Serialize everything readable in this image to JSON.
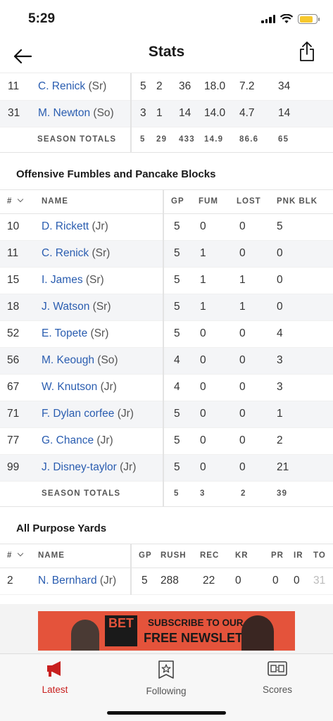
{
  "status": {
    "time": "5:29"
  },
  "nav": {
    "title": "Stats"
  },
  "top_table": {
    "rows": [
      {
        "num": "11",
        "name": "C. Renick",
        "yr": "(Sr)",
        "vals": [
          "5",
          "2",
          "36",
          "18.0",
          "7.2",
          "34"
        ]
      },
      {
        "num": "31",
        "name": "M. Newton",
        "yr": "(So)",
        "vals": [
          "3",
          "1",
          "14",
          "14.0",
          "4.7",
          "14"
        ]
      }
    ],
    "totals_label": "SEASON TOTALS",
    "totals": [
      "5",
      "29",
      "433",
      "14.9",
      "86.6",
      "65"
    ]
  },
  "fumbles": {
    "title": "Offensive Fumbles and Pancake Blocks",
    "headers": {
      "num": "#",
      "name": "NAME",
      "gp": "GP",
      "fum": "FUM",
      "lost": "LOST",
      "pnk": "PNK BLK"
    },
    "rows": [
      {
        "num": "10",
        "name": "D. Rickett",
        "yr": "(Jr)",
        "gp": "5",
        "fum": "0",
        "lost": "0",
        "pnk": "5"
      },
      {
        "num": "11",
        "name": "C. Renick",
        "yr": "(Sr)",
        "gp": "5",
        "fum": "1",
        "lost": "0",
        "pnk": "0"
      },
      {
        "num": "15",
        "name": "I. James",
        "yr": "(Sr)",
        "gp": "5",
        "fum": "1",
        "lost": "1",
        "pnk": "0"
      },
      {
        "num": "18",
        "name": "J. Watson",
        "yr": "(Sr)",
        "gp": "5",
        "fum": "1",
        "lost": "1",
        "pnk": "0"
      },
      {
        "num": "52",
        "name": "E. Topete",
        "yr": "(Sr)",
        "gp": "5",
        "fum": "0",
        "lost": "0",
        "pnk": "4"
      },
      {
        "num": "56",
        "name": "M. Keough",
        "yr": "(So)",
        "gp": "4",
        "fum": "0",
        "lost": "0",
        "pnk": "3"
      },
      {
        "num": "67",
        "name": "W. Knutson",
        "yr": "(Jr)",
        "gp": "4",
        "fum": "0",
        "lost": "0",
        "pnk": "3"
      },
      {
        "num": "71",
        "name": "F. Dylan corfee",
        "yr": "(Jr)",
        "gp": "5",
        "fum": "0",
        "lost": "0",
        "pnk": "1"
      },
      {
        "num": "77",
        "name": "G. Chance",
        "yr": "(Jr)",
        "gp": "5",
        "fum": "0",
        "lost": "0",
        "pnk": "2"
      },
      {
        "num": "99",
        "name": "J. Disney-taylor",
        "yr": "(Jr)",
        "gp": "5",
        "fum": "0",
        "lost": "0",
        "pnk": "21"
      }
    ],
    "totals_label": "SEASON TOTALS",
    "totals": {
      "gp": "5",
      "fum": "3",
      "lost": "2",
      "pnk": "39"
    }
  },
  "apy": {
    "title": "All Purpose Yards",
    "headers": {
      "num": "#",
      "name": "NAME",
      "gp": "GP",
      "rush": "RUSH",
      "rec": "REC",
      "kr": "KR",
      "pr": "PR",
      "ir": "IR",
      "to": "TO"
    },
    "rows": [
      {
        "num": "2",
        "name": "N. Bernhard",
        "yr": "(Jr)",
        "gp": "5",
        "rush": "288",
        "rec": "22",
        "kr": "0",
        "pr": "0",
        "ir": "0",
        "to": "31"
      }
    ]
  },
  "ad": {
    "logo": "BET",
    "line1": "SUBSCRIBE TO OUR",
    "line2": "FREE NEWSLETTER"
  },
  "tabs": [
    {
      "label": "Latest",
      "icon": "megaphone-icon"
    },
    {
      "label": "Following",
      "icon": "star-doc-icon"
    },
    {
      "label": "Scores",
      "icon": "scoreboard-icon"
    }
  ],
  "colors": {
    "accent": "#c8201f",
    "link": "#2a5db0",
    "ad_bg": "#e4533b"
  }
}
